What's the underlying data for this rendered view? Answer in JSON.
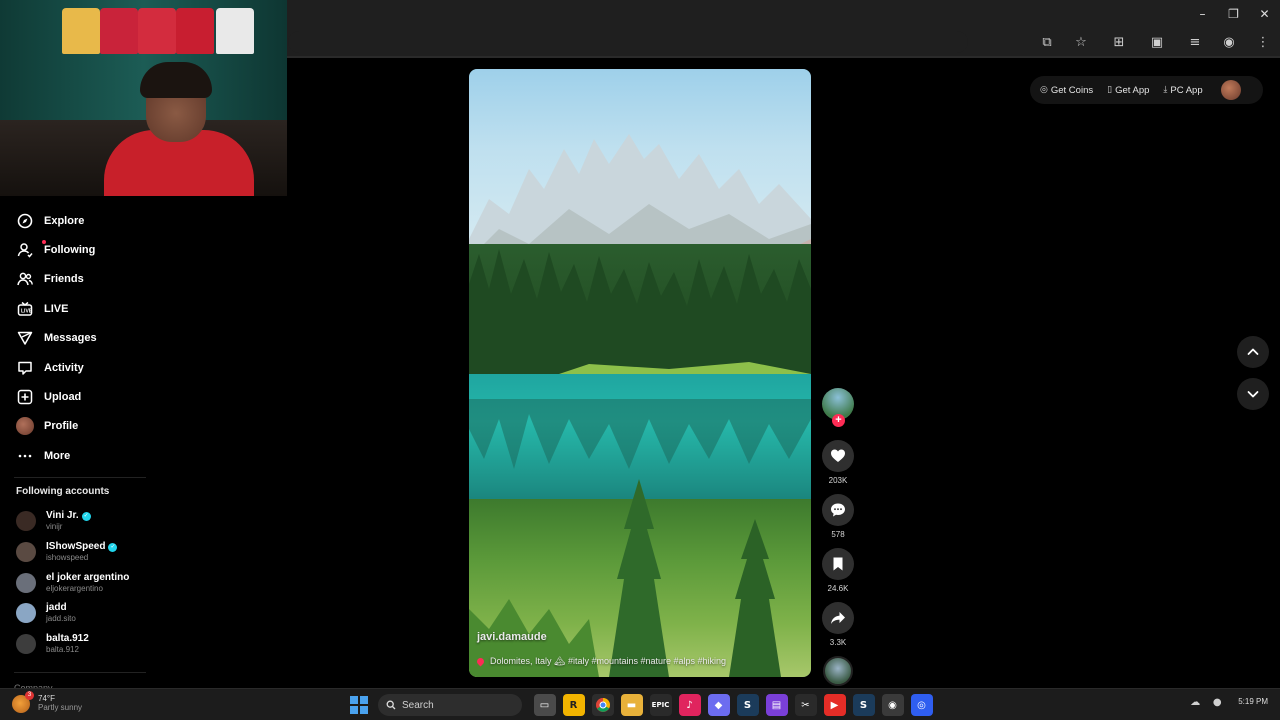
{
  "window": {
    "controls": [
      "minimize",
      "restore",
      "close"
    ]
  },
  "toolbar": {
    "icons": [
      "cast-icon",
      "star-icon",
      "extensions-icon",
      "tab-search-icon",
      "media-icon",
      "profile-icon",
      "menu-icon"
    ]
  },
  "sidebar": {
    "items": [
      {
        "label": "Explore",
        "icon": "compass-icon"
      },
      {
        "label": "Following",
        "icon": "following-icon"
      },
      {
        "label": "Friends",
        "icon": "friends-icon"
      },
      {
        "label": "LIVE",
        "icon": "live-icon"
      },
      {
        "label": "Messages",
        "icon": "messages-icon"
      },
      {
        "label": "Activity",
        "icon": "activity-icon"
      },
      {
        "label": "Upload",
        "icon": "upload-icon"
      },
      {
        "label": "Profile",
        "icon": "profile-avatar"
      },
      {
        "label": "More",
        "icon": "more-icon"
      }
    ],
    "following_title": "Following accounts",
    "accounts": [
      {
        "name": "Vini Jr.",
        "handle": "vinijr",
        "verified": true,
        "color": "#3a2a24"
      },
      {
        "name": "IShowSpeed",
        "handle": "ishowspeed",
        "verified": true,
        "color": "#5a4a42"
      },
      {
        "name": "el joker argentino",
        "handle": "eljokerargentino",
        "verified": false,
        "color": "#6a6f7a"
      },
      {
        "name": "jadd",
        "handle": "jadd.sito",
        "verified": false,
        "color": "#8aa6c4"
      },
      {
        "name": "balta.912",
        "handle": "balta.912",
        "verified": false,
        "color": "#3d3d3d"
      }
    ],
    "company": "Company"
  },
  "video": {
    "author": "javi.damaude",
    "caption": "Dolomites, Italy 🏔 #italy #mountains #nature #alps #hiking"
  },
  "actions": {
    "likes": "203K",
    "comments": "578",
    "saves": "24.6K",
    "shares": "3.3K"
  },
  "topbar": {
    "get_coins": "Get Coins",
    "get_app": "Get App",
    "pc_app": "PC App"
  },
  "taskbar": {
    "search_label": "Search",
    "weather_temp": "74°F",
    "weather_desc": "Partly sunny",
    "time": "5:19 PM",
    "apps": [
      {
        "name": "file-explorer-icon",
        "color": "#e3a71b",
        "glyph": ""
      },
      {
        "name": "rockstar-icon",
        "color": "#f2b400",
        "glyph": "R"
      },
      {
        "name": "chrome-icon",
        "color": "#2d2d2d",
        "glyph": ""
      },
      {
        "name": "folder-icon",
        "color": "#e8b13a",
        "glyph": ""
      },
      {
        "name": "epic-games-icon",
        "color": "#2a2a2a",
        "glyph": "E"
      },
      {
        "name": "tiktok-icon",
        "color": "#e0245e",
        "glyph": "♪"
      },
      {
        "name": "controller-icon",
        "color": "#6c6cf0",
        "glyph": "◆"
      },
      {
        "name": "steam-icon",
        "color": "#1b3b5a",
        "glyph": "S"
      },
      {
        "name": "editor-icon",
        "color": "#7a3fd8",
        "glyph": "▤"
      },
      {
        "name": "capcut-icon",
        "color": "#2a2a2a",
        "glyph": "✂"
      },
      {
        "name": "youtube-icon",
        "color": "#e52d27",
        "glyph": "▶"
      },
      {
        "name": "steam-icon-2",
        "color": "#1b3b5a",
        "glyph": "S"
      },
      {
        "name": "obs-icon",
        "color": "#3a3a3a",
        "glyph": "◉"
      },
      {
        "name": "app-icon",
        "color": "#2f5ef0",
        "glyph": "◎"
      }
    ]
  },
  "colors": {
    "accent": "#fe2c55",
    "verified": "#20d5ec",
    "background": "#000000"
  }
}
